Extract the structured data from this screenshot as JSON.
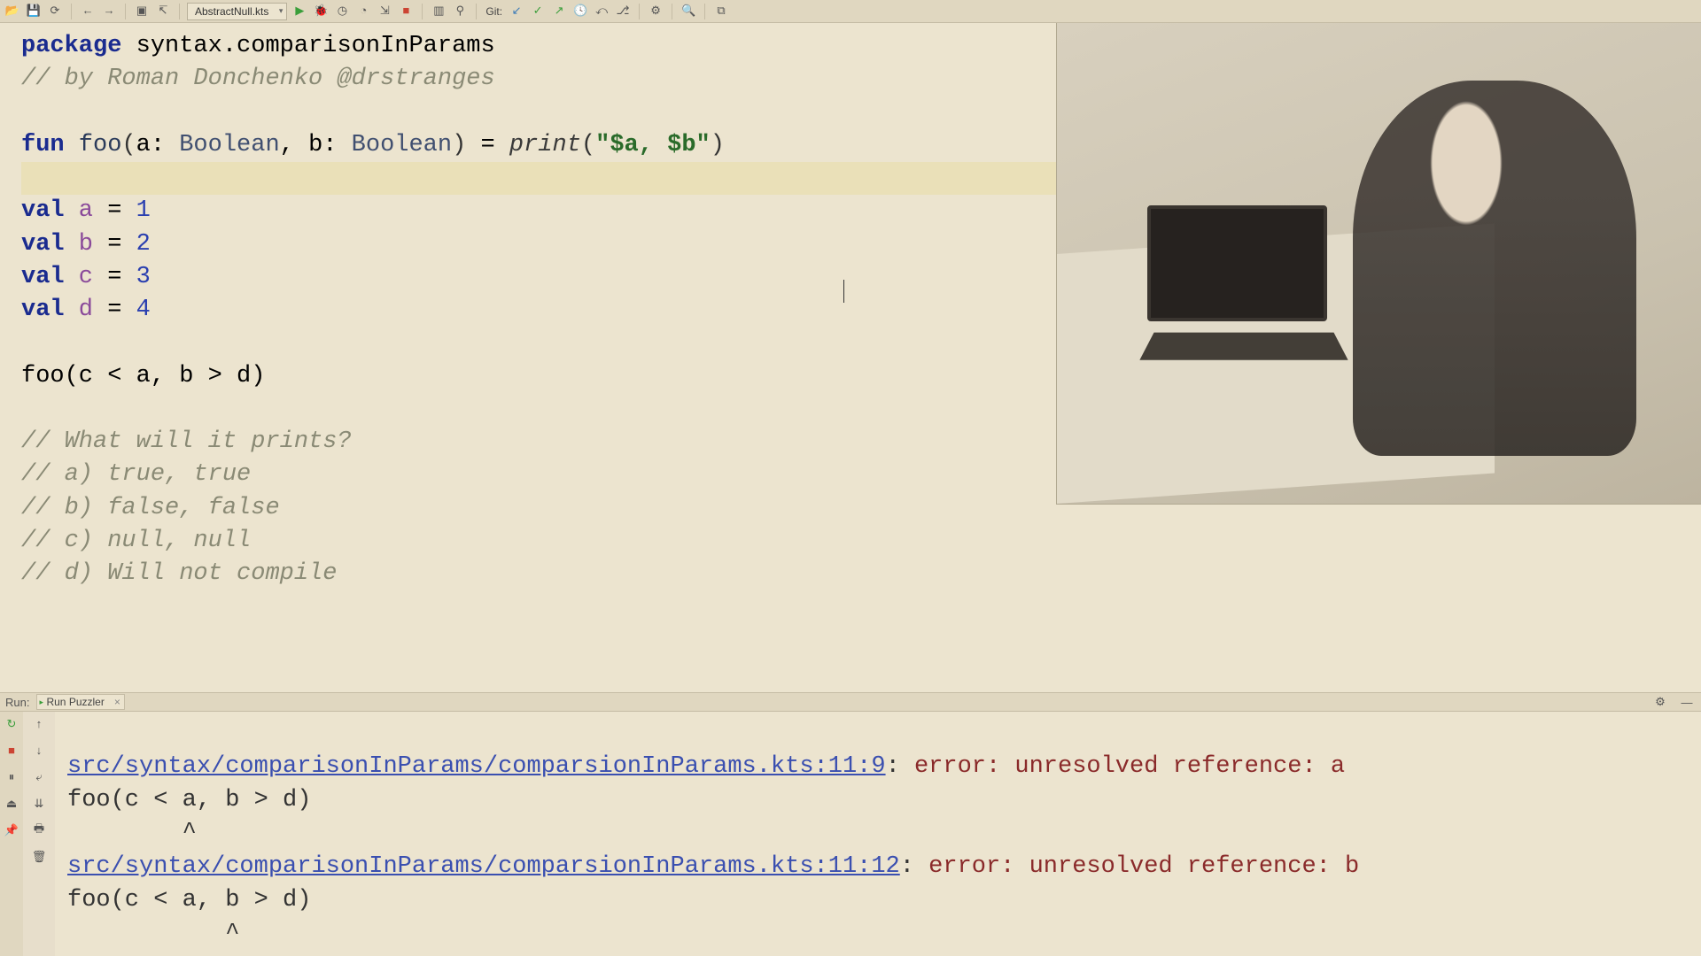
{
  "toolbar": {
    "run_config": "AbstractNull.kts",
    "git_label": "Git:"
  },
  "code": {
    "kw_package": "package",
    "package_name": " syntax.comparisonInParams",
    "comment_author": "// by Roman Donchenko @drstranges",
    "kw_fun": "fun",
    "fn_name": " foo",
    "fn_open": "(",
    "param_a": "a",
    "colon1": ": ",
    "type_bool1": "Boolean",
    "comma1": ", ",
    "param_b": "b",
    "colon2": ": ",
    "type_bool2": "Boolean",
    "fn_close": ")",
    "eq": " = ",
    "call_print": "print",
    "paren_open2": "(",
    "str_lit": "\"$a, $b\"",
    "paren_close2": ")",
    "kw_val": "val",
    "decl_a": " a",
    "eq_a": " = ",
    "num_a": "1",
    "decl_b": " b",
    "eq_b": " = ",
    "num_b": "2",
    "decl_c": " c",
    "eq_c": " = ",
    "num_c": "3",
    "decl_d": " d",
    "eq_d": " = ",
    "num_d": "4",
    "call_line": "foo(c < a, b > d)",
    "q_title": "// What will it prints?",
    "q_a": "// a) true, true",
    "q_b": "// b) false, false",
    "q_c": "// c) null, null",
    "q_d": "// d) Will not compile"
  },
  "run": {
    "label": "Run:",
    "tab": "Run Puzzler",
    "err1_link": "src/syntax/comparisonInParams/comparsionInParams.kts:11:9",
    "err1_colon": ": ",
    "err1_msg": "error: unresolved reference: a",
    "err1_src": "foo(c < a, b > d)",
    "err1_caret": "        ^",
    "err2_link": "src/syntax/comparisonInParams/comparsionInParams.kts:11:12",
    "err2_colon": ": ",
    "err2_msg": "error: unresolved reference: b",
    "err2_src": "foo(c < a, b > d)",
    "err2_caret": "           ^"
  }
}
